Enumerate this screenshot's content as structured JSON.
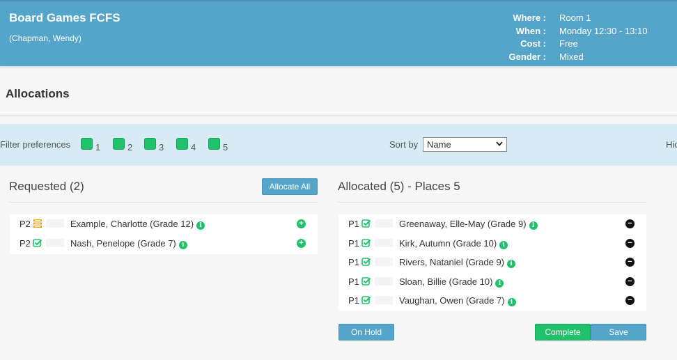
{
  "header": {
    "title": "Board Games FCFS",
    "subtitle": "(Chapman, Wendy)",
    "meta": [
      {
        "key": "Where :",
        "value": "Room 1"
      },
      {
        "key": "When :",
        "value": "Monday 12:30 - 13:10"
      },
      {
        "key": "Cost :",
        "value": "Free"
      },
      {
        "key": "Gender :",
        "value": "Mixed"
      }
    ]
  },
  "section_title": "Allocations",
  "filter": {
    "label": "Filter preferences",
    "prefs": [
      "1",
      "2",
      "3",
      "4",
      "5"
    ],
    "sort_label": "Sort by",
    "sort_value": "Name",
    "hide_label": "Hic"
  },
  "requested": {
    "title": "Requested (2)",
    "allocate_all_label": "Allocate All",
    "rows": [
      {
        "pref": "P2",
        "status": "stack-icon",
        "name": "Example, Charlotte (Grade 12)"
      },
      {
        "pref": "P2",
        "status": "check-icon",
        "name": "Nash, Penelope (Grade 7)"
      }
    ]
  },
  "allocated": {
    "title": "Allocated (5) - Places 5",
    "rows": [
      {
        "pref": "P1",
        "status": "check-icon",
        "name": "Greenaway, Elle-May (Grade 9)"
      },
      {
        "pref": "P1",
        "status": "check-icon",
        "name": "Kirk, Autumn (Grade 10)"
      },
      {
        "pref": "P1",
        "status": "check-icon",
        "name": "Rivers, Nataniel (Grade 9)"
      },
      {
        "pref": "P1",
        "status": "check-icon",
        "name": "Sloan, Billie (Grade 10)"
      },
      {
        "pref": "P1",
        "status": "check-icon",
        "name": "Vaughan, Owen (Grade 7)"
      }
    ],
    "on_hold_label": "On Hold",
    "complete_label": "Complete",
    "save_label": "Save"
  },
  "colors": {
    "header_bg": "#55a4c9",
    "accent_green": "#1fc26b",
    "stack_orange": "#f0a21a",
    "filter_bg": "#d7ebf4"
  }
}
